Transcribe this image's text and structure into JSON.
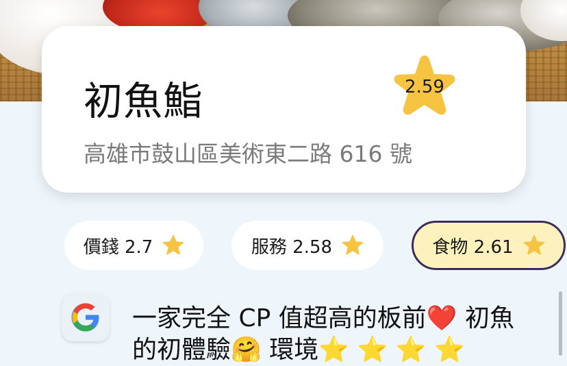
{
  "restaurant": {
    "name": "初魚鮨",
    "address": "高雄市鼓山區美術東二路 616 號",
    "rating": "2.59"
  },
  "categories": [
    {
      "label": "價錢 2.7",
      "selected": false
    },
    {
      "label": "服務 2.58",
      "selected": false
    },
    {
      "label": "食物 2.61",
      "selected": true
    }
  ],
  "review": {
    "source_icon": "google-icon",
    "text": "一家完全 CP 值超高的板前❤️ 初魚的初體驗🤗 環境⭐️ ⭐️ ⭐️ ⭐️"
  },
  "colors": {
    "star": "#f6c342",
    "selected_chip_bg": "#fdf1bd",
    "selected_chip_border": "#3a2e5c",
    "page_bg": "#eef6fb"
  },
  "icons": {
    "rating": "star-icon",
    "chip": "star-icon"
  }
}
